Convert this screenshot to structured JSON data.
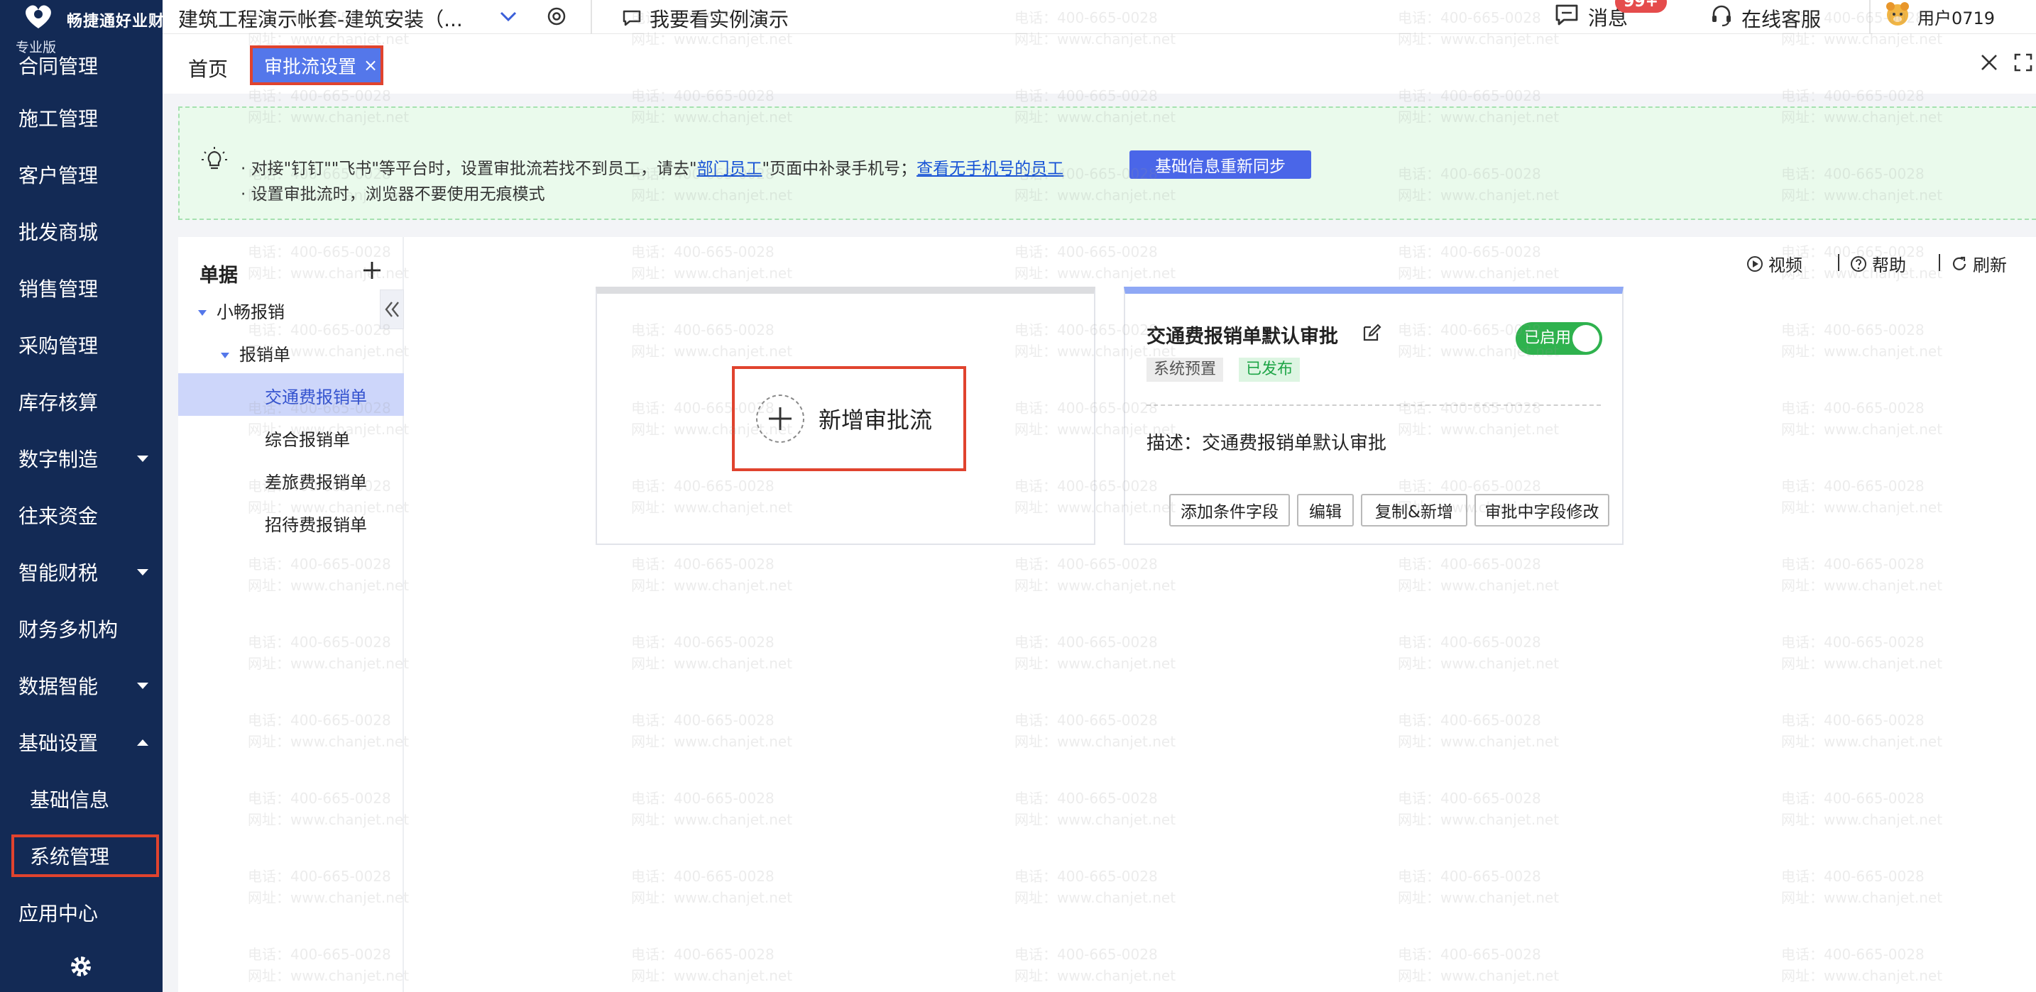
{
  "brand": {
    "name": "畅捷通好业财",
    "edition": "专业版"
  },
  "sidebar": {
    "items": [
      {
        "label": "合同管理"
      },
      {
        "label": "施工管理"
      },
      {
        "label": "客户管理"
      },
      {
        "label": "批发商城"
      },
      {
        "label": "销售管理"
      },
      {
        "label": "采购管理"
      },
      {
        "label": "库存核算"
      },
      {
        "label": "数字制造"
      },
      {
        "label": "往来资金"
      },
      {
        "label": "智能财税"
      },
      {
        "label": "财务多机构"
      },
      {
        "label": "数据智能"
      },
      {
        "label": "基础设置"
      },
      {
        "label": "基础信息"
      },
      {
        "label": "系统管理"
      },
      {
        "label": "应用中心"
      }
    ]
  },
  "topbar": {
    "company": "建筑工程演示帐套-建筑安装（...",
    "demo_link": "我要看实例演示",
    "messages": "消息",
    "message_badge": "99+",
    "customer_service": "在线客服",
    "user": "用户0719"
  },
  "tabs": {
    "home": "首页",
    "active": "审批流设置",
    "close": "×"
  },
  "notice": {
    "line1_a": "· 对接\"钉钉\"\"飞书\"等平台时，设置审批流若找不到员工，请去\"",
    "line1_link": "部门员工",
    "line1_b": "\"页面中补录手机号；",
    "line1_link2": "查看无手机号的员工",
    "line2": "· 设置审批流时，浏览器不要使用无痕模式",
    "sync_button": "基础信息重新同步"
  },
  "tree": {
    "title": "单据",
    "nodes": [
      "小畅报销",
      "报销单",
      "交通费报销单",
      "综合报销单",
      "差旅费报销单",
      "招待费报销单"
    ]
  },
  "toolbar": {
    "video": "视频",
    "help": "帮助",
    "refresh": "刷新"
  },
  "add_card": {
    "label": "新增审批流"
  },
  "flow_card": {
    "title": "交通费报销单默认审批",
    "toggle": "已启用",
    "tag_system": "系统预置",
    "tag_published": "已发布",
    "description": "描述：交通费报销单默认审批",
    "buttons": [
      "添加条件字段",
      "编辑",
      "复制&新增",
      "审批中字段修改"
    ]
  },
  "watermark": {
    "phone": "电话：400-665-0028",
    "site": "网址：www.chanjet.net"
  },
  "colors": {
    "sidebar": "#132a55",
    "accent": "#5477ea",
    "highlight": "#e0432e",
    "success": "#2fb24e"
  }
}
